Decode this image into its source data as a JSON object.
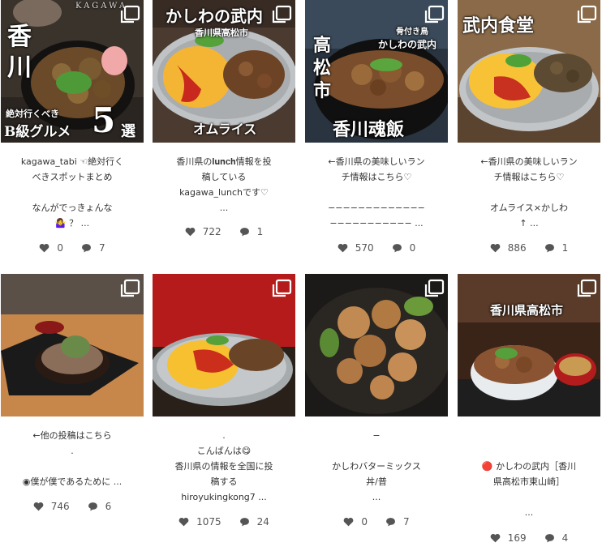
{
  "posts": [
    {
      "overlays": [
        "香",
        "川",
        "KAGAWA",
        "絶対行くべき",
        "B級グルメ",
        "5",
        "選"
      ],
      "caption": "kagawa_tabi ☜絶対行く\nべきスポットまとめ\n\nなんがでっきょんな\n🤷‍♀️ ？ ...",
      "likes": "0",
      "comments": "7"
    },
    {
      "overlays": [
        "かしわの武内",
        "香川県高松市",
        "オムライス"
      ],
      "caption": "香川県の𝐥𝐮𝐧𝐜𝐡情報を投\n稿している\nkagawa_lunchです♡\n...",
      "likes": "722",
      "comments": "1"
    },
    {
      "overlays": [
        "高",
        "松",
        "市",
        "骨付き鳥",
        "かしわの武内",
        "香川魂飯"
      ],
      "caption": "←香川県の美味しいラン\nチ情報はこちら♡\n\n−−−−−−−−−−−−−\n−−−−−−−−−−− ...",
      "likes": "570",
      "comments": "0"
    },
    {
      "overlays": [
        "武内食堂"
      ],
      "caption": "←香川県の美味しいラン\nチ情報はこちら♡\n\nオムライス×かしわ\n↑ ...",
      "likes": "886",
      "comments": "1"
    },
    {
      "overlays": [],
      "caption": "←他の投稿はこちら\n.\n\n◉僕が僕であるために ...",
      "likes": "746",
      "comments": "6"
    },
    {
      "overlays": [],
      "caption": ".\nこんばんは😋\n香川県の情報を全国に投\n稿する\nhiroyukingkong7 ...",
      "likes": "1075",
      "comments": "24"
    },
    {
      "overlays": [],
      "caption": "−\n\nかしわバターミックス\n丼/普\n...",
      "likes": "0",
      "comments": "7"
    },
    {
      "overlays": [
        "香川県高松市"
      ],
      "caption": "🔴 かしわの武内［香川\n県高松市東山崎］\n\n...",
      "likes": "169",
      "comments": "4"
    }
  ]
}
